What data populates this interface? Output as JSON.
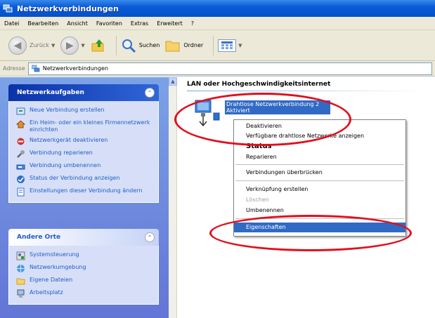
{
  "window": {
    "title": "Netzwerkverbindungen"
  },
  "menu": [
    "Datei",
    "Bearbeiten",
    "Ansicht",
    "Favoriten",
    "Extras",
    "Erweitert",
    "?"
  ],
  "toolbar": {
    "back": "Zurück",
    "search": "Suchen",
    "folders": "Ordner"
  },
  "address": {
    "label": "Adresse",
    "value": "Netzwerkverbindungen"
  },
  "tasks_panel": {
    "title": "Netzwerkaufgaben",
    "items": [
      "Neue Verbindung erstellen",
      "Ein Heim- oder ein kleines Firmennetzwerk einrichten",
      "Netzwerkgerät deaktivieren",
      "Verbindung reparieren",
      "Verbindung umbenennen",
      "Status der Verbindung anzeigen",
      "Einstellungen dieser Verbindung ändern"
    ]
  },
  "places_panel": {
    "title": "Andere Orte",
    "items": [
      "Systemsteuerung",
      "Netzwerkumgebung",
      "Eigene Dateien",
      "Arbeitsplatz"
    ]
  },
  "content": {
    "section_title": "LAN oder Hochgeschwindigkeitsinternet",
    "connection_line1": "Drahtlose Netzwerkverbindung 2",
    "connection_line2": "Aktiviert"
  },
  "context_menu": {
    "items": [
      "Deaktivieren",
      "Verfügbare drahtlose Netzwerke anzeigen",
      "Status",
      "Reparieren",
      "Verbindungen überbrücken",
      "Verknüpfung erstellen",
      "Löschen",
      "Umbenennen",
      "Eigenschaften"
    ]
  },
  "colors": {
    "highlight": "#316ac5",
    "annotation": "#e0101e",
    "xp_blue": "#0552c8"
  }
}
